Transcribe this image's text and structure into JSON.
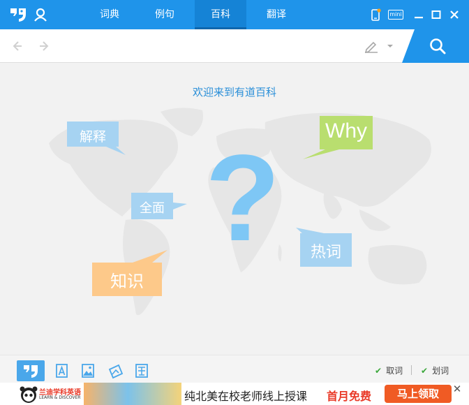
{
  "titlebar": {
    "tabs": [
      {
        "label": "词典"
      },
      {
        "label": "例句"
      },
      {
        "label": "百科",
        "active": true
      },
      {
        "label": "翻译"
      }
    ],
    "mini_label": "mini",
    "accent": "#1f94ea"
  },
  "search": {
    "value": "",
    "placeholder": ""
  },
  "main": {
    "welcome": "欢迎来到有道百科",
    "bubbles": {
      "explain": "解释",
      "why": "Why",
      "comprehensive": "全面",
      "hot_words": "热词",
      "knowledge": "知识"
    },
    "question_mark": "?"
  },
  "bottombar": {
    "tools": [
      "logo-tool",
      "text-tool",
      "image-tool",
      "screenshot-tool",
      "translate-tool"
    ],
    "options": [
      {
        "label": "取词",
        "checked": true
      },
      {
        "label": "划词",
        "checked": true
      }
    ]
  },
  "ad": {
    "brand": "兰迪学科英语",
    "brand_sub": "LEARN & DISCOVER",
    "text": "纯北美在校老师线上授课",
    "highlight": "首月免费",
    "cta": "马上领取",
    "close": "✕"
  }
}
